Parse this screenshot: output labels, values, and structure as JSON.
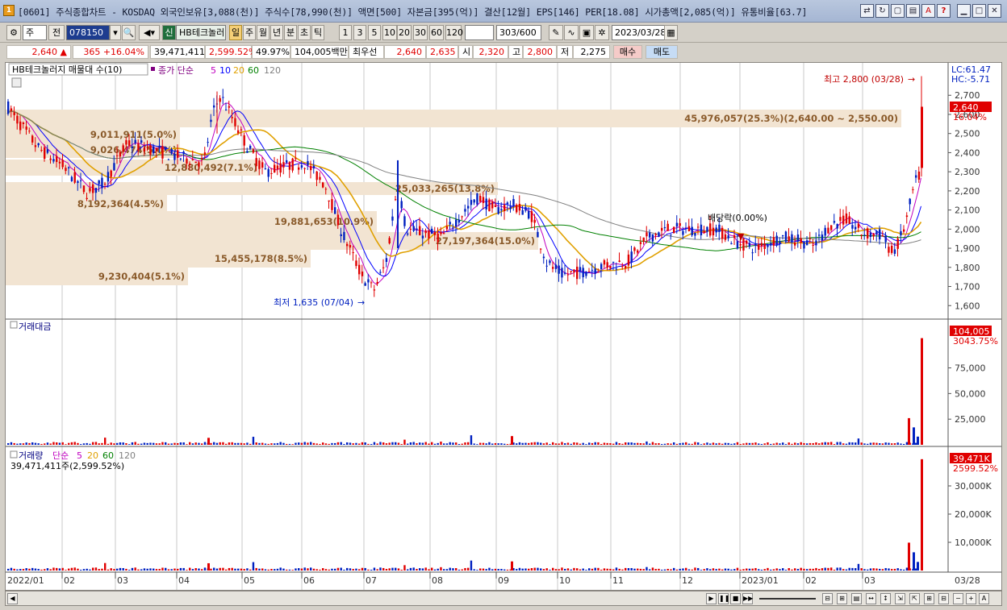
{
  "window": {
    "title": "[0601] 주식종합차트 - KOSDAQ 외국인보유[3,088(천)] 주식수[78,990(천)] 액면[500] 자본금[395(억)] 결산[12월] EPS[146] PER[18.08] 시가총액[2,085(억)] 유통비율[63.7]",
    "icon": "1"
  },
  "toolbar": {
    "market": "주",
    "prev": "전",
    "code": "078150",
    "name": "HB테크놀러",
    "sin": "신",
    "period_buttons": [
      "일",
      "주",
      "월",
      "년",
      "분",
      "초",
      "틱"
    ],
    "selected_period": "일",
    "interval_buttons": [
      "1",
      "3",
      "5",
      "10",
      "20",
      "30",
      "60",
      "120"
    ],
    "count": "303",
    "count_max": "/600",
    "date": "2023/03/28"
  },
  "info": {
    "price": "2,640",
    "arrow": "▲",
    "change": "365",
    "change_pct": "+16.04%",
    "volume": "39,471,411",
    "volume_pct": "2,599.52%",
    "ratio": "49.97%",
    "amount": "104,005백만",
    "best": "최우선",
    "ask": "2,640",
    "bid": "2,635",
    "open_label": "시",
    "open": "2,320",
    "high_label": "고",
    "high": "2,800",
    "low_label": "저",
    "low": "2,275",
    "buy": "매수",
    "sell": "매도"
  },
  "price_panel": {
    "title": "HB테크놀러지 매물대 수(10)",
    "ma_label": "종가 단순",
    "ma_periods": [
      "5",
      "10",
      "20",
      "60",
      "120"
    ],
    "lc": "LC:61.47",
    "hc": "HC:-5.71",
    "high_note": "최고 2,800 (03/28)",
    "low_note": "최저 1,635 (07/04)",
    "dividend_note": "배당락(0.00%)",
    "cur_price_tag": "2,640",
    "cur_pct": "16.04%",
    "y_ticks": [
      "2,700",
      "2,600",
      "2,500",
      "2,400",
      "2,300",
      "2,200",
      "2,100",
      "2,000",
      "1,900",
      "1,800",
      "1,700",
      "1,600"
    ],
    "volume_profile": [
      "45,976,057(25.3%)(2,640.00 ~ 2,550.00)",
      "9,011,911(5.0%)",
      "9,026,474(5.0%)",
      "12,880,492(7.1%)",
      "8,192,364(4.5%)",
      "25,033,265(13.8%)",
      "19,881,653(10.9%)",
      "27,197,364(15.0%)",
      "15,455,178(8.5%)",
      "9,230,404(5.1%)"
    ]
  },
  "amount_panel": {
    "title": "거래대금",
    "tag": "104,005",
    "tag_pct": "3043.75%",
    "y_ticks": [
      "75,000",
      "50,000",
      "25,000"
    ]
  },
  "volume_panel": {
    "title": "거래량",
    "ma_label": "단순",
    "ma_periods": [
      "5",
      "20",
      "60",
      "120"
    ],
    "value_text": "39,471,411주(2,599.52%)",
    "tag": "39,471K",
    "tag_pct": "2599.52%",
    "y_ticks": [
      "30,000K",
      "20,000K",
      "10,000K"
    ]
  },
  "x_axis": [
    "2022/01",
    "02",
    "03",
    "04",
    "05",
    "06",
    "07",
    "08",
    "09",
    "10",
    "11",
    "12",
    "2023/01",
    "02",
    "03",
    "03/28"
  ],
  "colors": {
    "up": "#e00000",
    "down": "#0020c0",
    "ma5": "#c000c0",
    "ma10": "#0000ff",
    "ma20": "#e0a000",
    "ma60": "#008000",
    "ma120": "#808080",
    "profile": "#f2e4d2"
  },
  "chart_data": {
    "type": "candlestick",
    "series": "HB테크놀러지 daily",
    "last": {
      "date": "2023/03/28",
      "open": 2320,
      "high": 2800,
      "low": 2275,
      "close": 2640
    },
    "period_high": 2800,
    "period_low": 1635,
    "ylim": [
      1580,
      2760
    ]
  }
}
